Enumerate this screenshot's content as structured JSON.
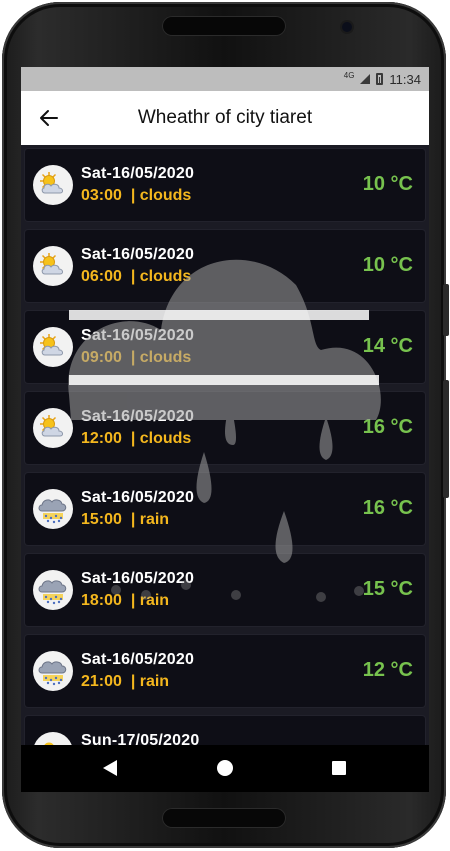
{
  "status_bar": {
    "network": "4G",
    "time": "11:34"
  },
  "app_bar": {
    "title": "Wheathr of city tiaret",
    "back_icon": "arrow-left-icon"
  },
  "forecast": [
    {
      "date": "Sat-16/05/2020",
      "time_condition": "03:00  | clouds",
      "temperature": "10 °C",
      "icon": "partly-cloudy-icon"
    },
    {
      "date": "Sat-16/05/2020",
      "time_condition": "06:00  | clouds",
      "temperature": "10 °C",
      "icon": "partly-cloudy-icon"
    },
    {
      "date": "Sat-16/05/2020",
      "time_condition": "09:00  | clouds",
      "temperature": "14 °C",
      "icon": "partly-cloudy-icon"
    },
    {
      "date": "Sat-16/05/2020",
      "time_condition": "12:00  | clouds",
      "temperature": "16 °C",
      "icon": "partly-cloudy-icon"
    },
    {
      "date": "Sat-16/05/2020",
      "time_condition": "15:00  | rain",
      "temperature": "16 °C",
      "icon": "rain-cloud-icon"
    },
    {
      "date": "Sat-16/05/2020",
      "time_condition": "18:00  | rain",
      "temperature": "15 °C",
      "icon": "rain-cloud-icon"
    },
    {
      "date": "Sat-16/05/2020",
      "time_condition": "21:00  | rain",
      "temperature": "12 °C",
      "icon": "rain-cloud-icon"
    },
    {
      "date": "Sun-17/05/2020",
      "time_condition": "",
      "temperature": "",
      "icon": "partly-cloudy-icon"
    }
  ],
  "background_watermark": "rain-cloud-icon",
  "nav_bar": {
    "back": "nav-back-icon",
    "home": "nav-home-icon",
    "recents": "nav-recents-icon"
  },
  "colors": {
    "date_text": "#ffffff",
    "time_condition_text": "#f4b71e",
    "temperature_text": "#77c24e",
    "row_background": "#0e0e16"
  }
}
